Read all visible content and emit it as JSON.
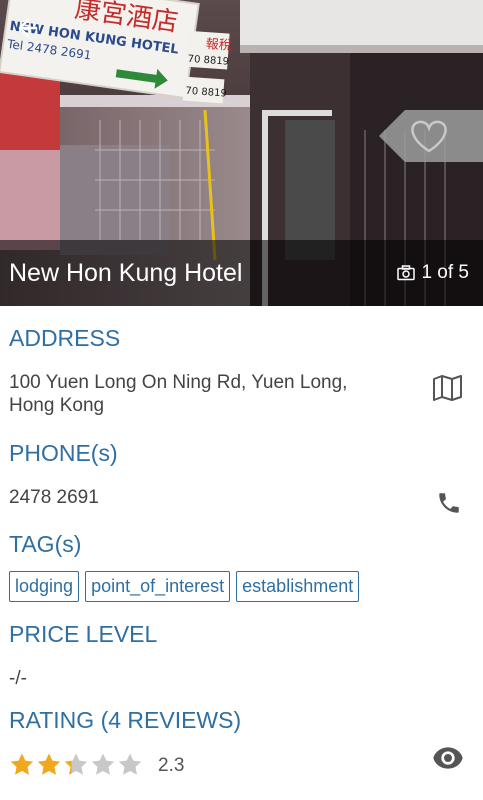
{
  "hero": {
    "hotel_name": "New Hon Kung Hotel",
    "photo_counter": "1 of 5",
    "sign_chinese": "康宮酒店",
    "sign_english": "NEW HON KUNG HOTEL",
    "sign_phone": "Tel 2478 2691",
    "side_sign_1": "70 8819",
    "side_sign_2": "70 8819",
    "side_sign_chinese": "報稅",
    "back_icon": "arrow-left-icon",
    "favorite_icon": "heart-outline-icon",
    "camera_icon": "camera-icon"
  },
  "address": {
    "title": "ADDRESS",
    "line1": "100 Yuen Long On Ning Rd, Yuen Long,",
    "line2": "Hong Kong",
    "icon": "map-icon"
  },
  "phone": {
    "title": "PHONE(s)",
    "value": "2478 2691",
    "icon": "phone-icon"
  },
  "tags": {
    "title": "TAG(s)",
    "items": [
      "lodging",
      "point_of_interest",
      "establishment"
    ]
  },
  "price": {
    "title": "PRICE LEVEL",
    "value": "-/-"
  },
  "rating": {
    "title": "RATING (4 REVIEWS)",
    "value": "2.3",
    "stars_filled": 2.3,
    "stars_total": 5,
    "icon": "eye-icon"
  },
  "colors": {
    "accent": "#2f6fa3",
    "star_filled": "#f0a81c",
    "star_empty": "#c8c8c8",
    "body_text": "#444444"
  }
}
